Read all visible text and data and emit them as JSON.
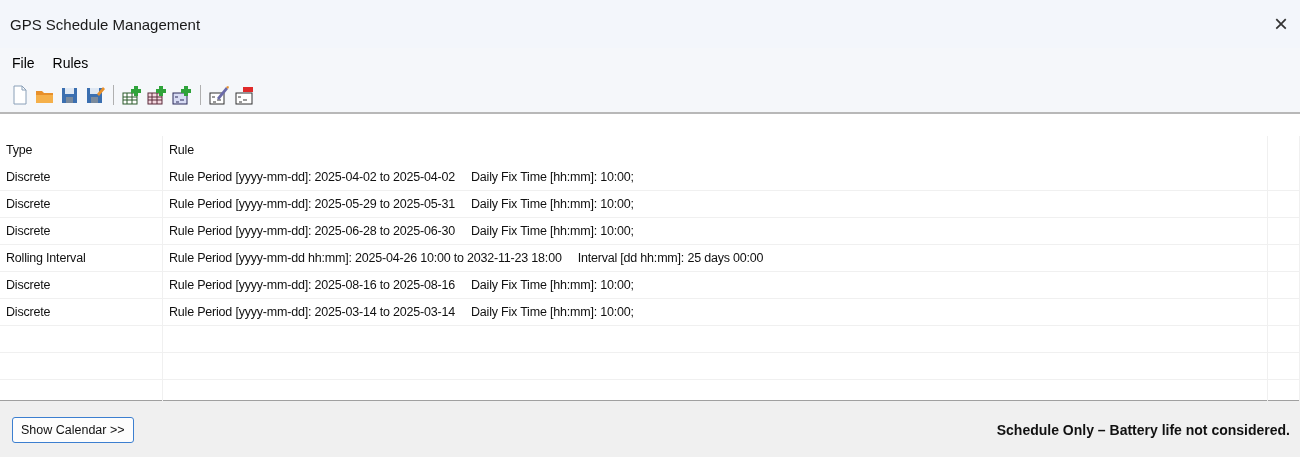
{
  "window": {
    "title": "GPS Schedule Management",
    "close": "×"
  },
  "menu": [
    "File",
    "Rules"
  ],
  "table": {
    "columns": [
      "Type",
      "Rule"
    ],
    "rows": [
      {
        "type": "Discrete",
        "period": "Rule Period [yyyy-mm-dd]: 2025-04-02 to 2025-04-02",
        "detail": "Daily Fix Time [hh:mm]: 10:00;"
      },
      {
        "type": "Discrete",
        "period": "Rule Period [yyyy-mm-dd]: 2025-05-29 to 2025-05-31",
        "detail": "Daily Fix Time [hh:mm]: 10:00;"
      },
      {
        "type": "Discrete",
        "period": "Rule Period [yyyy-mm-dd]: 2025-06-28 to 2025-06-30",
        "detail": "Daily Fix Time [hh:mm]: 10:00;"
      },
      {
        "type": "Rolling Interval",
        "period": "Rule Period [yyyy-mm-dd hh:mm]: 2025-04-26 10:00 to 2032-11-23 18:00",
        "detail": "Interval [dd hh:mm]: 25 days 00:00"
      },
      {
        "type": "Discrete",
        "period": "Rule Period [yyyy-mm-dd]: 2025-08-16 to 2025-08-16",
        "detail": "Daily Fix Time [hh:mm]: 10:00;"
      },
      {
        "type": "Discrete",
        "period": "Rule Period [yyyy-mm-dd]: 2025-03-14 to 2025-03-14",
        "detail": "Daily Fix Time [hh:mm]: 10:00;"
      }
    ]
  },
  "footer": {
    "button": "Show Calendar >>",
    "status": "Schedule Only – Battery life not considered."
  }
}
